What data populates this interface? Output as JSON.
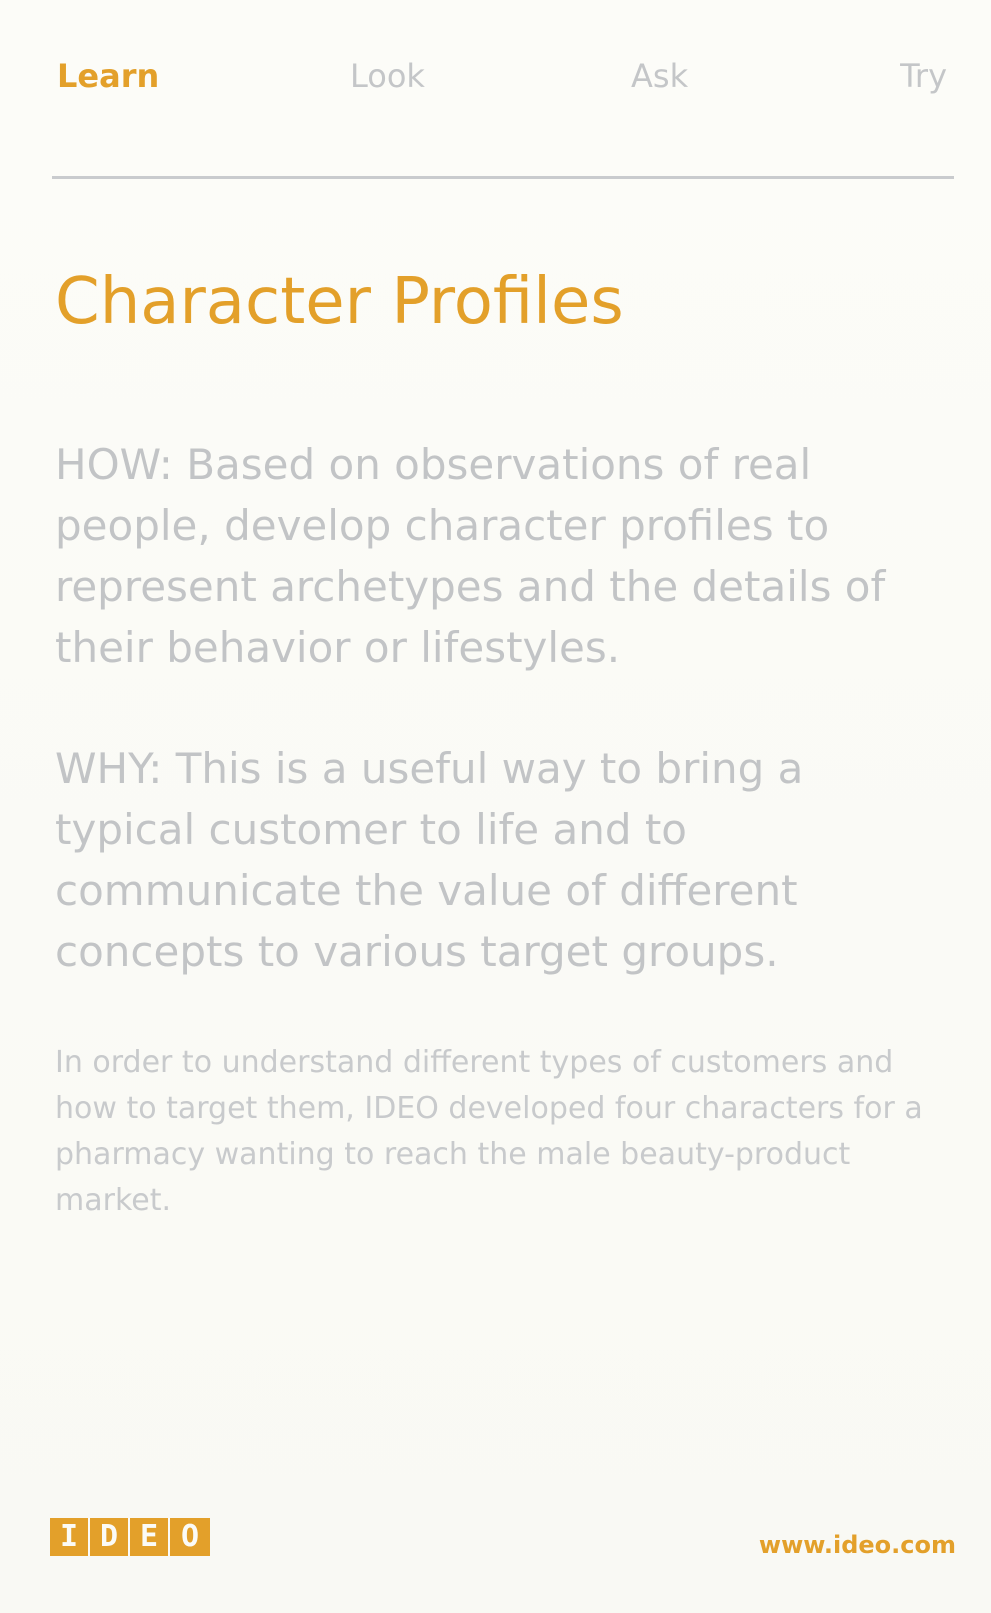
{
  "tabs": [
    {
      "label": "Learn",
      "active": true
    },
    {
      "label": "Look",
      "active": false
    },
    {
      "label": "Ask",
      "active": false
    },
    {
      "label": "Try",
      "active": false
    }
  ],
  "title": "Character Profiles",
  "how": "HOW: Based on observations of real people, develop character profiles to represent archetypes and the details of their behavior or lifestyles.",
  "why": "WHY: This is a useful way to bring a typical customer to life and to communicate the value of different concepts to various target groups.",
  "example": "In order to understand different types of customers and how to target them, IDEO developed four characters for a pharmacy wanting to reach the male beauty-product market.",
  "logo": {
    "letters": [
      "I",
      "D",
      "E",
      "O"
    ],
    "color": "#e3a02a"
  },
  "url": "www.ideo.com",
  "colors": {
    "accent": "#e3a02a",
    "muted_text": "#c2c4c6",
    "background": "#fbfbf7"
  }
}
